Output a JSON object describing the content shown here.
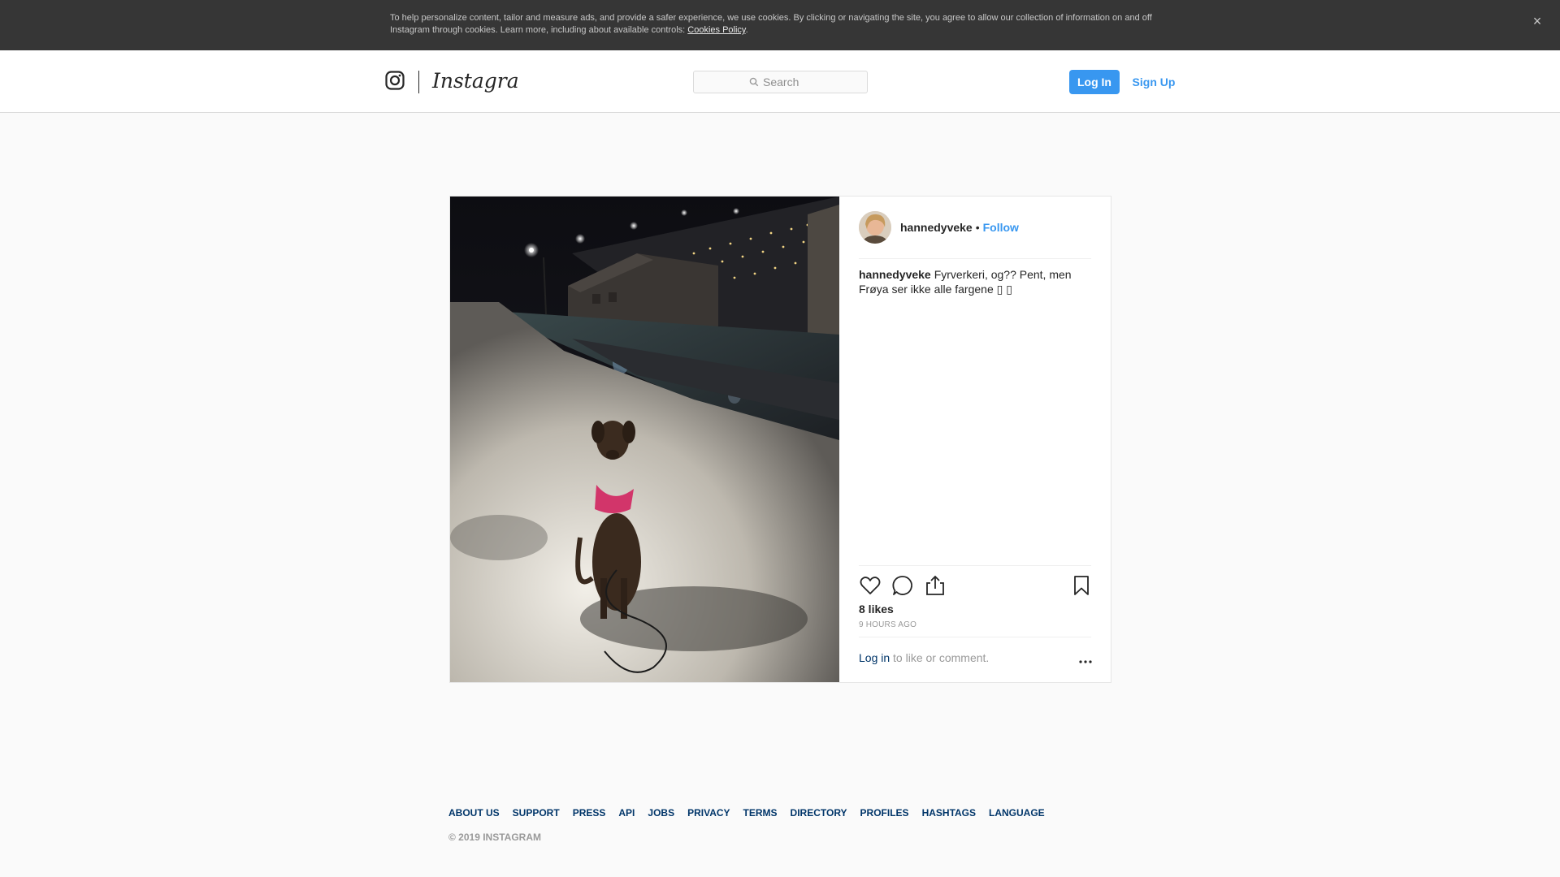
{
  "cookie_banner": {
    "text": "To help personalize content, tailor and measure ads, and provide a safer experience, we use cookies. By clicking or navigating the site, you agree to allow our collection of information on and off Instagram through cookies. Learn more, including about available controls: ",
    "link_label": "Cookies Policy",
    "close_icon": "×"
  },
  "header": {
    "brand": "Instagram",
    "search_placeholder": "Search",
    "login_label": "Log In",
    "signup_label": "Sign Up"
  },
  "post": {
    "author": "hannedyveke",
    "separator": "•",
    "follow_label": "Follow",
    "caption_user": "hannedyveke",
    "caption_text": "Fyrverkeri, og?? Pent, men Frøya ser ikke alle fargene ▯ ▯",
    "likes": "8 likes",
    "time_ago": "9 hours ago",
    "login_link": "Log in",
    "login_suffix": " to like or comment."
  },
  "footer": {
    "links": [
      "About us",
      "Support",
      "Press",
      "API",
      "Jobs",
      "Privacy",
      "Terms",
      "Directory",
      "Profiles",
      "Hashtags",
      "Language"
    ],
    "copyright": "© 2019 Instagram"
  },
  "colors": {
    "accent": "#3897f0",
    "link_dark": "#003569",
    "cookie_bg": "#363636"
  }
}
